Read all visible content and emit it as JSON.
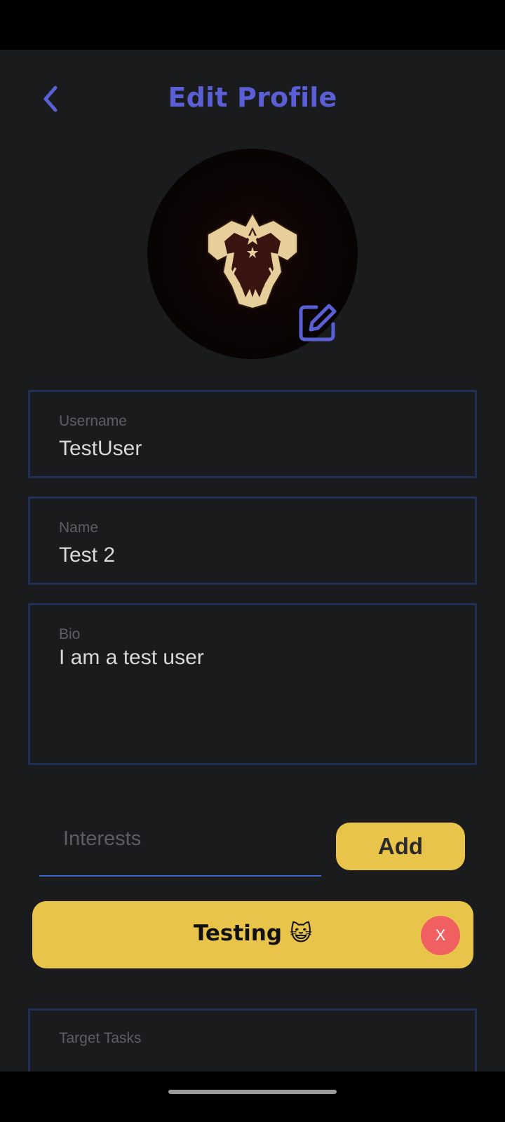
{
  "header": {
    "title": "Edit Profile",
    "back_icon": "chevron-left-icon"
  },
  "avatar": {
    "image": "black-bull-emblem",
    "edit_icon": "edit-icon"
  },
  "fields": {
    "username": {
      "label": "Username",
      "value": "TestUser"
    },
    "name": {
      "label": "Name",
      "value": "Test 2"
    },
    "bio": {
      "label": "Bio",
      "value": "I am a test user"
    },
    "target_tasks": {
      "label": "Target Tasks"
    }
  },
  "interests": {
    "placeholder": "Interests",
    "add_label": "Add",
    "chips": [
      {
        "label": "Testing 😺",
        "remove_label": "X"
      }
    ]
  },
  "colors": {
    "accent": "#5a5fd6",
    "button_yellow": "#e8c44a",
    "remove_red": "#f06060",
    "field_border": "#1f2f55",
    "underline": "#3d64c9",
    "background": "#1a1b1d"
  }
}
